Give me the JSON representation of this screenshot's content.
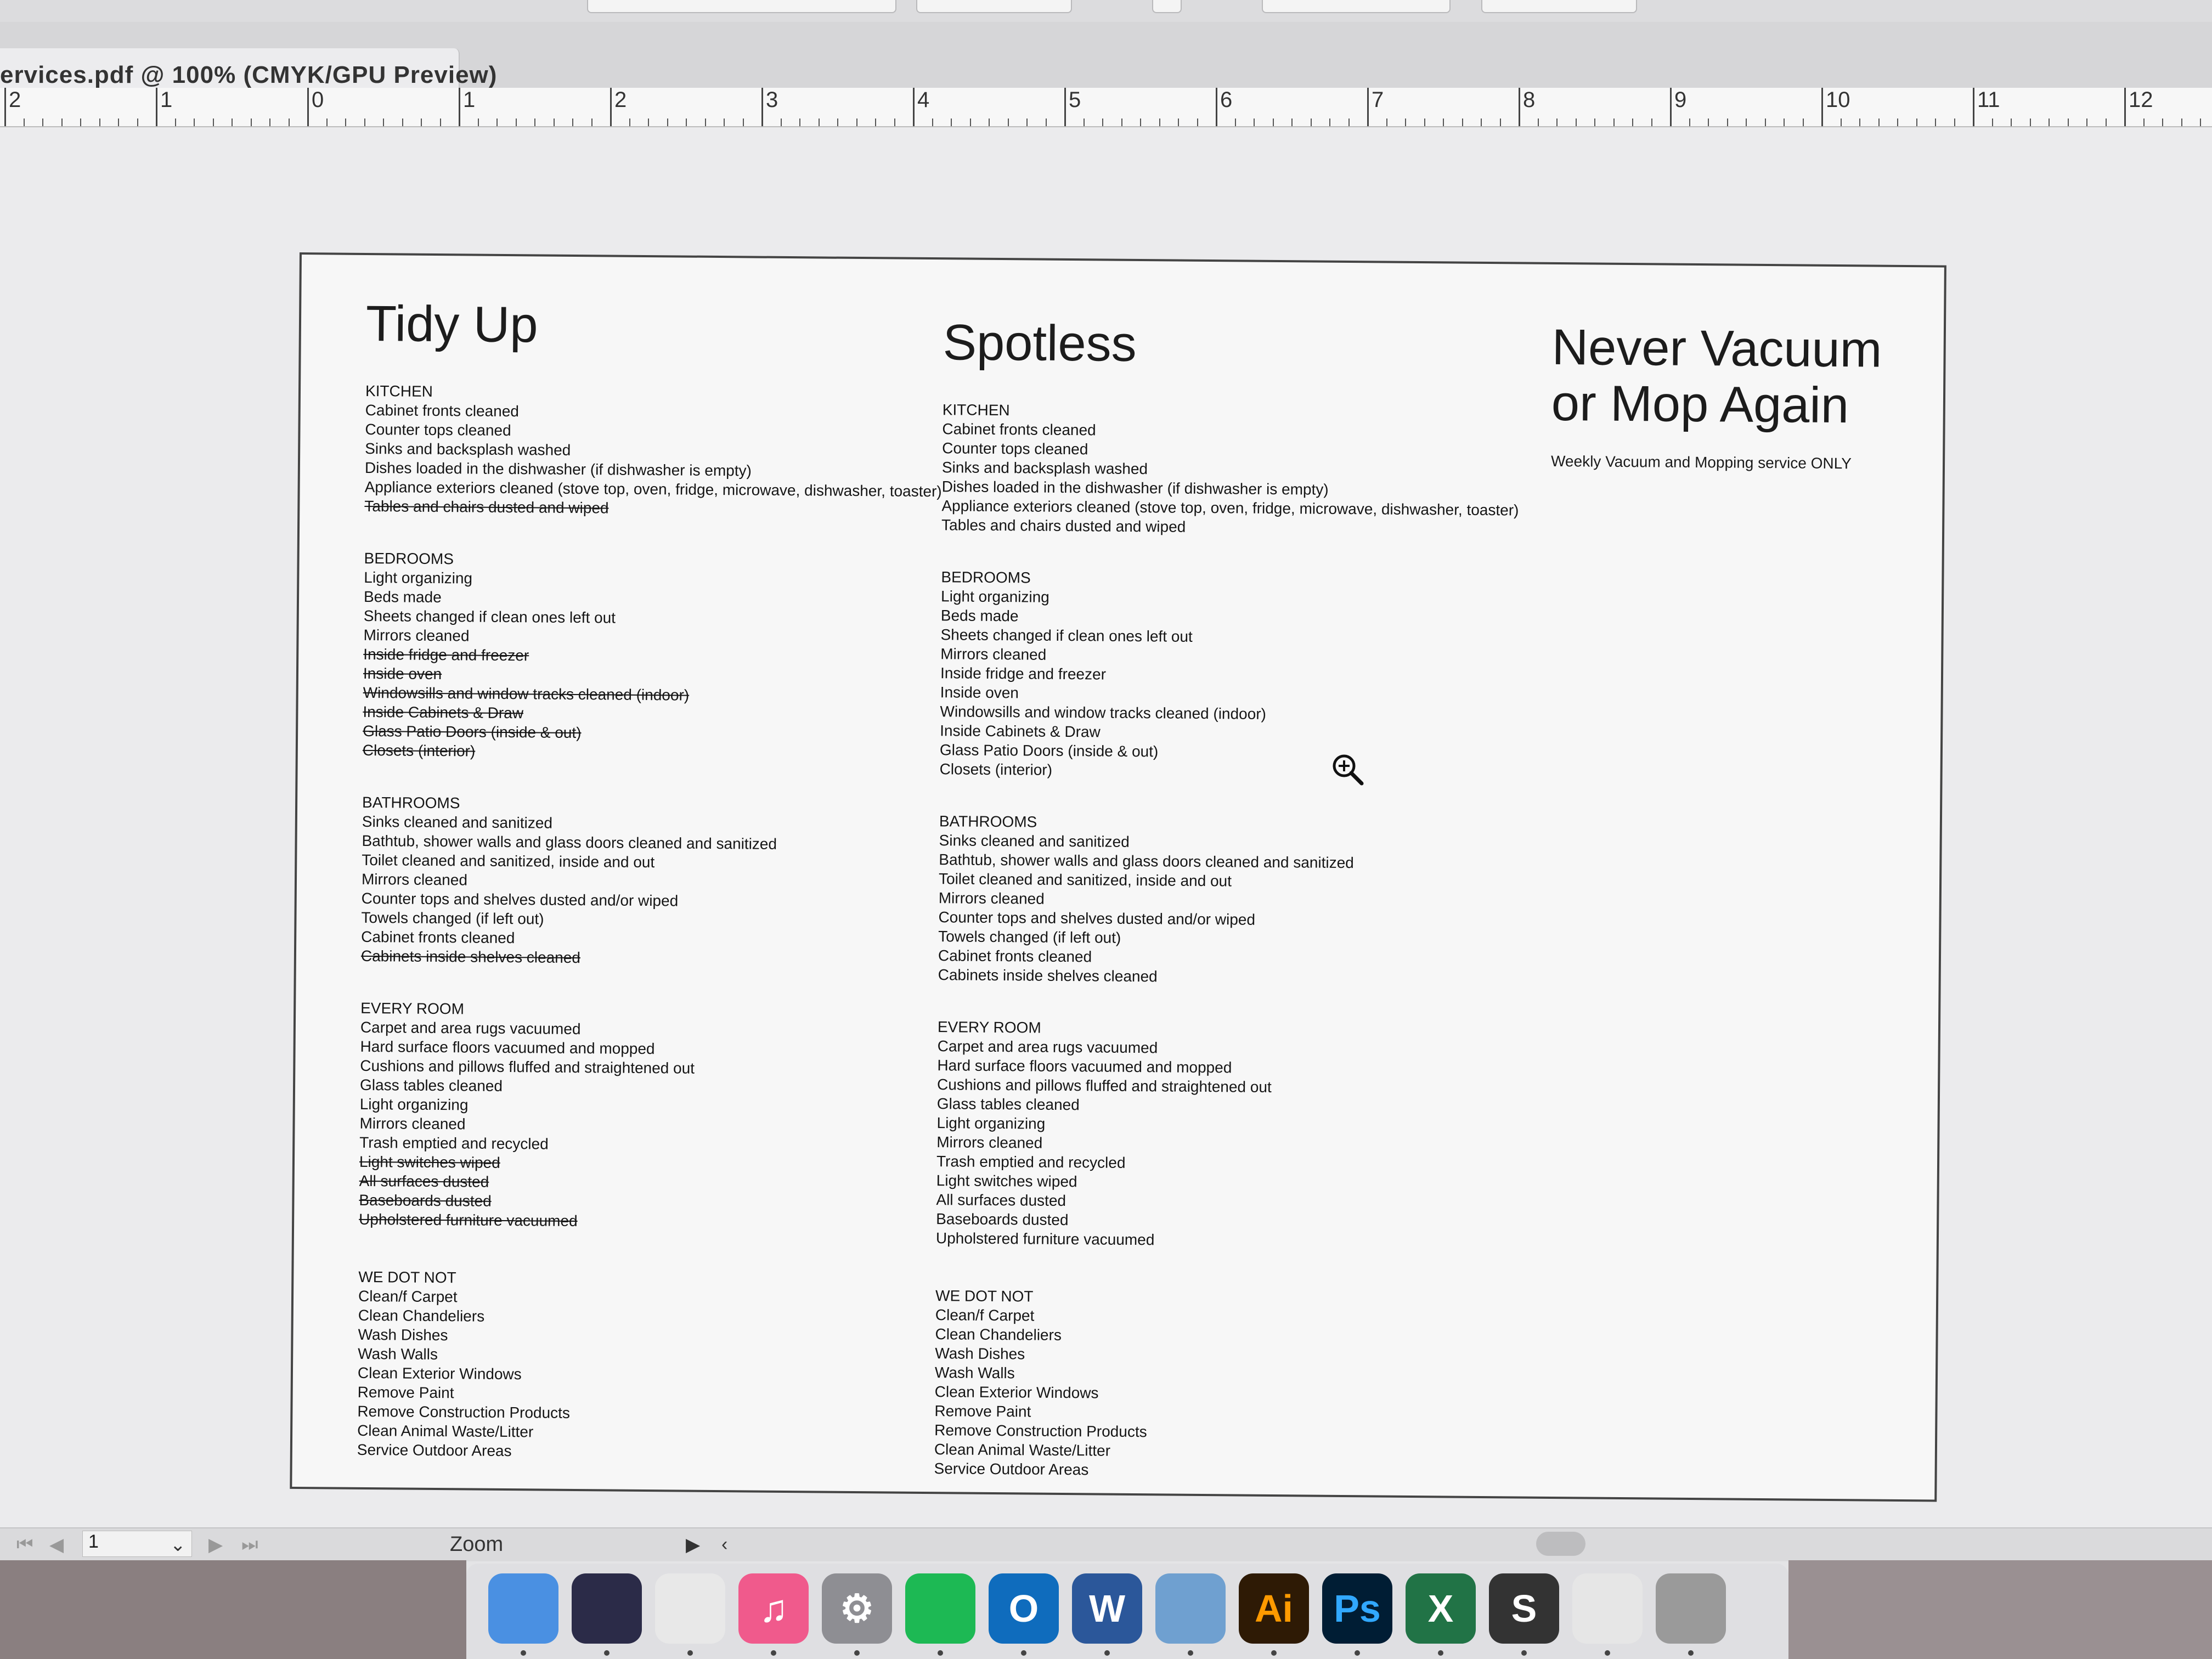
{
  "window": {
    "tab_title": "ervices.pdf @ 100% (CMYK/GPU Preview)"
  },
  "ruler": {
    "labels": [
      "2",
      "1",
      "0",
      "1",
      "2",
      "3",
      "4",
      "5",
      "6",
      "7",
      "8",
      "9",
      "10",
      "11",
      "12"
    ]
  },
  "document": {
    "tidy_up": {
      "title": "Tidy Up",
      "kitchen": {
        "heading": "KITCHEN",
        "items": [
          {
            "text": "Cabinet fronts cleaned",
            "struck": false
          },
          {
            "text": "Counter tops cleaned",
            "struck": false
          },
          {
            "text": "Sinks and backsplash washed",
            "struck": false
          },
          {
            "text": "Dishes loaded in the dishwasher (if dishwasher is empty)",
            "struck": false
          },
          {
            "text": "Appliance exteriors cleaned (stove top, oven, fridge, microwave, dishwasher, toaster)",
            "struck": false
          },
          {
            "text": "Tables and chairs dusted and wiped",
            "struck": true
          }
        ]
      },
      "bedrooms": {
        "heading": "BEDROOMS",
        "items": [
          {
            "text": "Light organizing",
            "struck": false
          },
          {
            "text": "Beds made",
            "struck": false
          },
          {
            "text": "Sheets changed if clean ones left out",
            "struck": false
          },
          {
            "text": "Mirrors cleaned",
            "struck": false
          },
          {
            "text": "Inside fridge and freezer",
            "struck": true
          },
          {
            "text": "Inside oven",
            "struck": true
          },
          {
            "text": "Windowsills and window tracks cleaned (indoor)",
            "struck": true
          },
          {
            "text": "Inside Cabinets & Draw",
            "struck": true
          },
          {
            "text": "Glass Patio Doors (inside & out)",
            "struck": true
          },
          {
            "text": "Closets (interior)",
            "struck": true
          }
        ]
      },
      "bathrooms": {
        "heading": "BATHROOMS",
        "items": [
          {
            "text": "Sinks cleaned and sanitized",
            "struck": false
          },
          {
            "text": "Bathtub, shower walls and glass doors cleaned and sanitized",
            "struck": false
          },
          {
            "text": "Toilet cleaned and sanitized, inside and out",
            "struck": false
          },
          {
            "text": "Mirrors cleaned",
            "struck": false
          },
          {
            "text": "Counter tops and shelves dusted and/or wiped",
            "struck": false
          },
          {
            "text": "Towels changed (if left out)",
            "struck": false
          },
          {
            "text": "Cabinet fronts cleaned",
            "struck": false
          },
          {
            "text": "Cabinets inside shelves cleaned",
            "struck": true
          }
        ]
      },
      "every_room": {
        "heading": "EVERY ROOM",
        "items": [
          {
            "text": "Carpet and area rugs vacuumed",
            "struck": false
          },
          {
            "text": "Hard surface floors vacuumed and mopped",
            "struck": false
          },
          {
            "text": "Cushions and pillows fluffed and straightened out",
            "struck": false
          },
          {
            "text": "Glass tables cleaned",
            "struck": false
          },
          {
            "text": "Light organizing",
            "struck": false
          },
          {
            "text": "Mirrors cleaned",
            "struck": false
          },
          {
            "text": "Trash emptied and recycled",
            "struck": false
          },
          {
            "text": "Light switches wiped",
            "struck": true
          },
          {
            "text": "All surfaces dusted",
            "struck": true
          },
          {
            "text": "Baseboards dusted",
            "struck": true
          },
          {
            "text": "Upholstered furniture vacuumed",
            "struck": true
          }
        ]
      },
      "we_do_not": {
        "heading": "WE DOT NOT",
        "items": [
          {
            "text": "Clean/f Carpet",
            "struck": false
          },
          {
            "text": "Clean Chandeliers",
            "struck": false
          },
          {
            "text": "Wash Dishes",
            "struck": false
          },
          {
            "text": "Wash Walls",
            "struck": false
          },
          {
            "text": "Clean Exterior Windows",
            "struck": false
          },
          {
            "text": "Remove Paint",
            "struck": false
          },
          {
            "text": "Remove Construction Products",
            "struck": false
          },
          {
            "text": "Clean Animal Waste/Litter",
            "struck": false
          },
          {
            "text": "Service Outdoor Areas",
            "struck": false
          }
        ]
      }
    },
    "spotless": {
      "title": "Spotless",
      "kitchen": {
        "heading": "KITCHEN",
        "items": [
          {
            "text": "Cabinet fronts cleaned",
            "struck": false
          },
          {
            "text": "Counter tops cleaned",
            "struck": false
          },
          {
            "text": "Sinks and backsplash washed",
            "struck": false
          },
          {
            "text": "Dishes loaded in the dishwasher (if dishwasher is empty)",
            "struck": false
          },
          {
            "text": "Appliance exteriors cleaned (stove top, oven, fridge, microwave, dishwasher, toaster)",
            "struck": false
          },
          {
            "text": "Tables and chairs dusted and wiped",
            "struck": false
          }
        ]
      },
      "bedrooms": {
        "heading": "BEDROOMS",
        "items": [
          {
            "text": "Light organizing",
            "struck": false
          },
          {
            "text": "Beds made",
            "struck": false
          },
          {
            "text": "Sheets changed if clean ones left out",
            "struck": false
          },
          {
            "text": "Mirrors cleaned",
            "struck": false
          },
          {
            "text": "Inside fridge and freezer",
            "struck": false
          },
          {
            "text": "Inside oven",
            "struck": false
          },
          {
            "text": "Windowsills and window tracks cleaned (indoor)",
            "struck": false
          },
          {
            "text": "Inside Cabinets & Draw",
            "struck": false
          },
          {
            "text": "Glass Patio Doors (inside & out)",
            "struck": false
          },
          {
            "text": "Closets (interior)",
            "struck": false
          }
        ]
      },
      "bathrooms": {
        "heading": "BATHROOMS",
        "items": [
          {
            "text": "Sinks cleaned and sanitized",
            "struck": false
          },
          {
            "text": "Bathtub, shower walls and glass doors cleaned and sanitized",
            "struck": false
          },
          {
            "text": "Toilet cleaned and sanitized, inside and out",
            "struck": false
          },
          {
            "text": "Mirrors cleaned",
            "struck": false
          },
          {
            "text": "Counter tops and shelves dusted and/or wiped",
            "struck": false
          },
          {
            "text": "Towels changed (if left out)",
            "struck": false
          },
          {
            "text": "Cabinet fronts cleaned",
            "struck": false
          },
          {
            "text": "Cabinets inside shelves cleaned",
            "struck": false
          }
        ]
      },
      "every_room": {
        "heading": "EVERY ROOM",
        "items": [
          {
            "text": "Carpet and area rugs vacuumed",
            "struck": false
          },
          {
            "text": "Hard surface floors vacuumed and mopped",
            "struck": false
          },
          {
            "text": "Cushions and pillows fluffed and straightened out",
            "struck": false
          },
          {
            "text": "Glass tables cleaned",
            "struck": false
          },
          {
            "text": "Light organizing",
            "struck": false
          },
          {
            "text": "Mirrors cleaned",
            "struck": false
          },
          {
            "text": "Trash emptied and recycled",
            "struck": false
          },
          {
            "text": "Light switches wiped",
            "struck": false
          },
          {
            "text": "All surfaces dusted",
            "struck": false
          },
          {
            "text": "Baseboards dusted",
            "struck": false
          },
          {
            "text": "Upholstered furniture vacuumed",
            "struck": false
          }
        ]
      },
      "we_do_not": {
        "heading": "WE DOT NOT",
        "items": [
          {
            "text": "Clean/f Carpet",
            "struck": false
          },
          {
            "text": "Clean Chandeliers",
            "struck": false
          },
          {
            "text": "Wash Dishes",
            "struck": false
          },
          {
            "text": "Wash Walls",
            "struck": false
          },
          {
            "text": "Clean Exterior Windows",
            "struck": false
          },
          {
            "text": "Remove Paint",
            "struck": false
          },
          {
            "text": "Remove Construction Products",
            "struck": false
          },
          {
            "text": "Clean Animal Waste/Litter",
            "struck": false
          },
          {
            "text": "Service Outdoor Areas",
            "struck": false
          }
        ]
      }
    },
    "never_vacuum": {
      "title_line1": "Never Vacuum",
      "title_line2": "or Mop Again",
      "subtitle": "Weekly Vacuum and Mopping service ONLY"
    }
  },
  "statusbar": {
    "page_number": "1",
    "zoom_label": "Zoom"
  },
  "dock": {
    "apps": [
      {
        "name": "Finder",
        "label": "",
        "color": "#4a90e2"
      },
      {
        "name": "Siri",
        "label": "",
        "color": "#2b2b48"
      },
      {
        "name": "Chrome",
        "label": "",
        "color": "#e8e8e8"
      },
      {
        "name": "iTunes",
        "label": "♫",
        "color": "#f05a8c"
      },
      {
        "name": "System Preferences",
        "label": "⚙",
        "color": "#8e8e93"
      },
      {
        "name": "Spotify",
        "label": "",
        "color": "#1db954"
      },
      {
        "name": "Outlook",
        "label": "O",
        "color": "#0f6cbd"
      },
      {
        "name": "Word",
        "label": "W",
        "color": "#2b579a"
      },
      {
        "name": "Preview",
        "label": "",
        "color": "#6fa0d0"
      },
      {
        "name": "Illustrator",
        "label": "Ai",
        "color": "#2e1a05"
      },
      {
        "name": "Photoshop",
        "label": "Ps",
        "color": "#001d34"
      },
      {
        "name": "Excel",
        "label": "X",
        "color": "#217346"
      },
      {
        "name": "Setapp",
        "label": "S",
        "color": "#333333"
      },
      {
        "name": "Outlook Window",
        "label": "",
        "color": "#e6e6e6"
      },
      {
        "name": "Trash",
        "label": "",
        "color": "#9a9a9a"
      }
    ]
  },
  "colors": {
    "accent_illustrator_text": "#ff9a00",
    "accent_photoshop_text": "#31a8ff"
  }
}
